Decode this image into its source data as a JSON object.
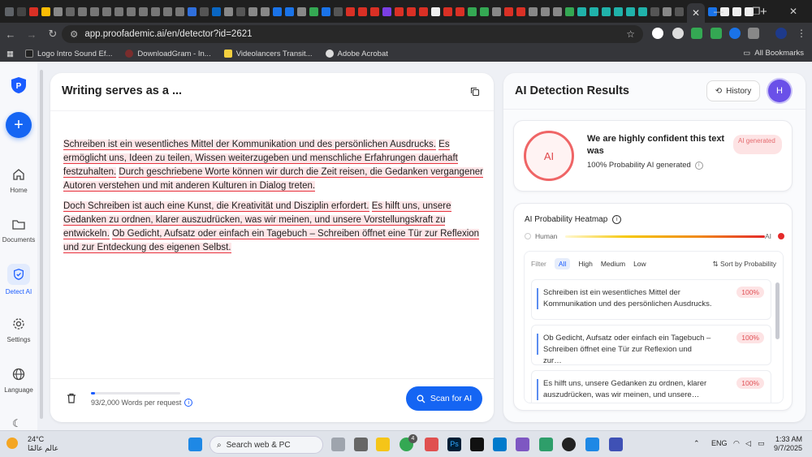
{
  "browser": {
    "url": "app.proofademic.ai/en/detector?id=2621",
    "bookmarks": [
      "Logo Intro Sound Ef...",
      "DownloadGram - In...",
      "Videolancers Transit...",
      "Adobe Acrobat"
    ],
    "all_bookmarks": "All Bookmarks",
    "active_tab_close": "✕",
    "new_tab": "+"
  },
  "sidebar": {
    "items": [
      {
        "label": "Home",
        "icon": "home-icon"
      },
      {
        "label": "Documents",
        "icon": "folder-icon"
      },
      {
        "label": "Detect AI",
        "icon": "shield-icon"
      },
      {
        "label": "Settings",
        "icon": "gear-icon"
      },
      {
        "label": "Language",
        "icon": "globe-icon"
      }
    ]
  },
  "editor": {
    "title": "Writing serves as a ...",
    "paragraph1": [
      "Schreiben ist ein wesentliches Mittel der Kommunikation und des persönlichen Ausdrucks.",
      "Es ermöglicht uns, Ideen zu teilen, Wissen weiterzugeben und menschliche Erfahrungen dauerhaft festzuhalten.",
      "Durch geschriebene Worte können wir durch die Zeit reisen, die Gedanken vergangener Autoren verstehen und mit anderen Kulturen in Dialog treten."
    ],
    "paragraph2": [
      "Doch Schreiben ist auch eine Kunst, die Kreativität und Disziplin erfordert.",
      "Es hilft uns, unsere Gedanken zu ordnen, klarer auszudrücken, was wir meinen, und unsere Vorstellungskraft zu entwickeln.",
      "Ob Gedicht, Aufsatz oder einfach ein Tagebuch – Schreiben öffnet eine Tür zur Reflexion und zur Entdeckung des eigenen Selbst."
    ],
    "word_count": "93/2,000 Words per request",
    "word_fraction": 0.0465,
    "scan_label": "Scan for AI"
  },
  "results": {
    "title": "AI Detection Results",
    "history_label": "History",
    "avatar_letter": "H",
    "ring_label": "AI",
    "confidence_text": "We are highly confident this text was",
    "probability_text": "100% Probability AI generated",
    "badge": "AI generated",
    "heatmap_title": "AI Probability Heatmap",
    "gradient_left": "Human",
    "gradient_right": "AI",
    "filter_label": "Filter",
    "filters": [
      "All",
      "High",
      "Medium",
      "Low"
    ],
    "sort_label": "Sort by Probability",
    "sentences": [
      {
        "text": "Schreiben ist ein wesentliches Mittel der Kommunikation und des persönlichen Ausdrucks.",
        "pct": "100%"
      },
      {
        "text": "Ob Gedicht, Aufsatz oder einfach ein Tagebuch – Schreiben öffnet eine Tür zur Reflexion und zur…",
        "pct": "100%"
      },
      {
        "text": "Es hilft uns, unsere Gedanken zu ordnen, klarer auszudrücken, was wir meinen, und unsere…",
        "pct": "100%"
      }
    ]
  },
  "taskbar": {
    "temp": "24°C",
    "weather_sub": "عالم عالمًا",
    "search": "Search web & PC",
    "lang": "ENG",
    "time": "1:33 AM",
    "date": "9/7/2025",
    "chrome_badge": "4"
  },
  "colors": {
    "accent": "#1565f3",
    "ai_red": "#e8343f",
    "highlight": "#fde6e8",
    "avatar": "#6a50e8"
  }
}
